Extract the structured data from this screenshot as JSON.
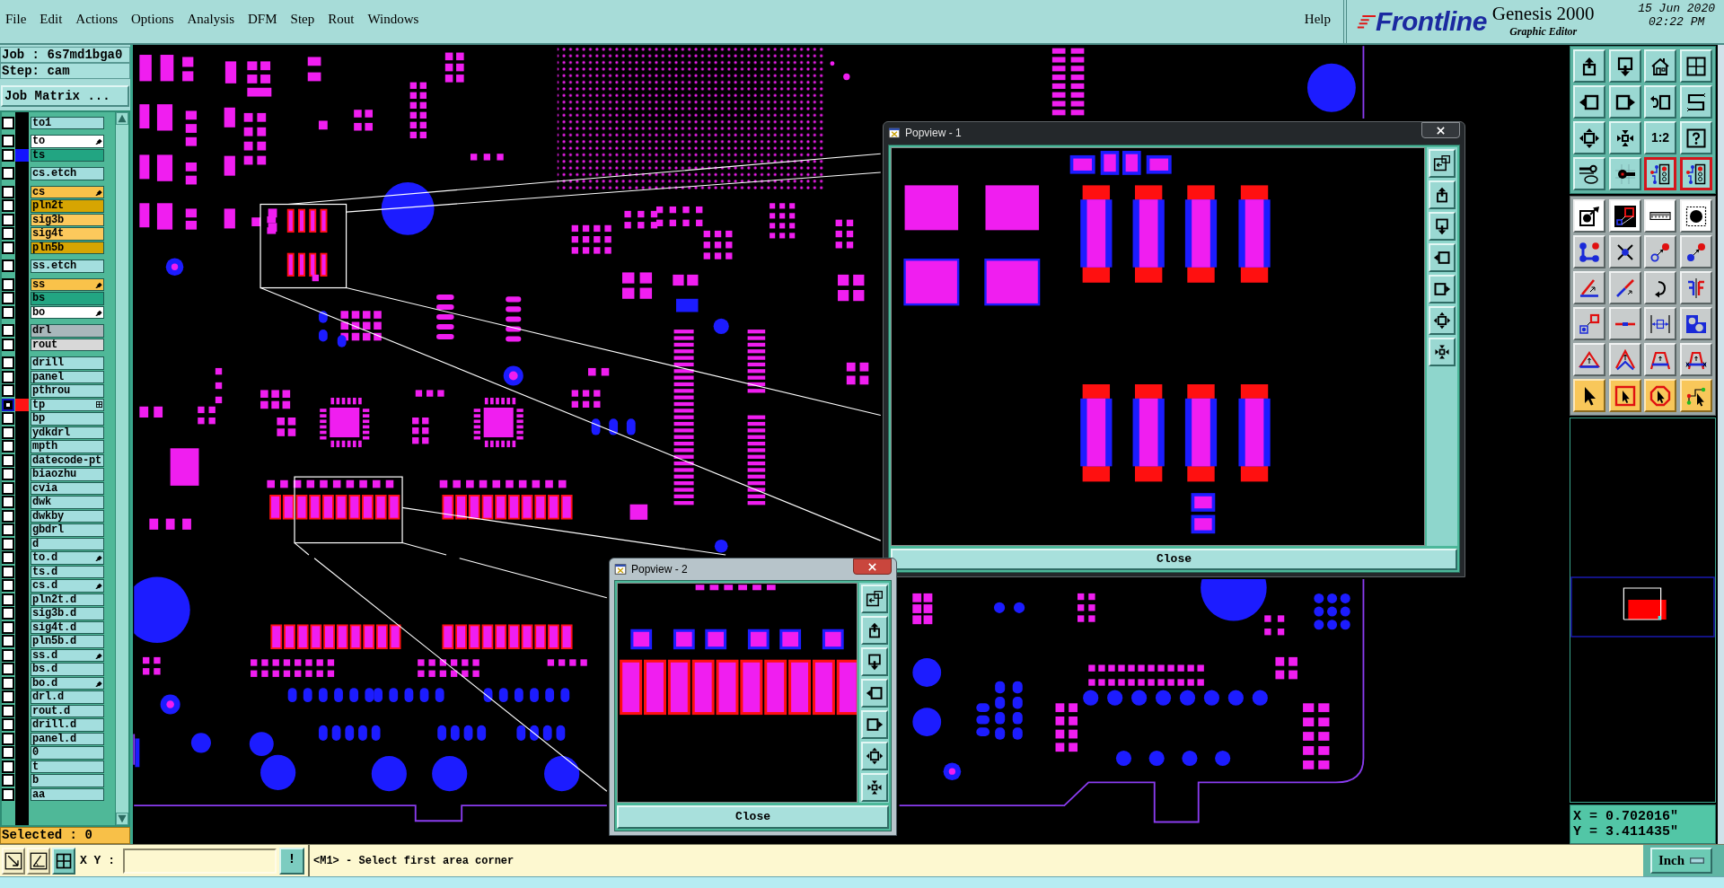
{
  "menu_bar": {
    "items": [
      "File",
      "Edit",
      "Actions",
      "Options",
      "Analysis",
      "DFM",
      "Step",
      "Rout",
      "Windows"
    ],
    "help": "Help"
  },
  "branding": {
    "logo": "Frontline",
    "product": "Genesis 2000",
    "subtitle": "Graphic Editor",
    "date": "15 Jun 2020",
    "time": "02:22 PM"
  },
  "job_panel": {
    "job": "Job : 6s7md1bga0",
    "step": "Step: cam",
    "matrix_button": "Job Matrix ...",
    "selected": "Selected : 0"
  },
  "layer_groups": [
    [
      {
        "name": "to1",
        "color": "#a3dede",
        "highlighted": false,
        "tagged": false,
        "work_layer": false
      }
    ],
    [
      {
        "name": "to",
        "color": "#ffffff",
        "highlighted": false,
        "tagged": true,
        "work_layer": false
      },
      {
        "name": "ts",
        "color": "#22a582",
        "swatch": {
          "color": "#1414ff"
        },
        "highlighted": false,
        "tagged": false,
        "work_layer": false
      }
    ],
    [
      {
        "name": "cs.etch",
        "color": "#a3dede",
        "highlighted": false,
        "tagged": false,
        "work_layer": false
      }
    ],
    [
      {
        "name": "cs",
        "color": "#f9c24a",
        "highlighted": false,
        "tagged": true,
        "work_layer": false
      },
      {
        "name": "pln2t",
        "color": "#d7a502",
        "highlighted": false,
        "tagged": false,
        "work_layer": false
      },
      {
        "name": "sig3b",
        "color": "#fcc95c",
        "highlighted": false,
        "tagged": false,
        "work_layer": false
      },
      {
        "name": "sig4t",
        "color": "#fcc95c",
        "highlighted": false,
        "tagged": false,
        "work_layer": false
      },
      {
        "name": "pln5b",
        "color": "#d7a502",
        "highlighted": false,
        "tagged": false,
        "work_layer": false
      }
    ],
    [
      {
        "name": "ss.etch",
        "color": "#a3dede",
        "highlighted": false,
        "tagged": false,
        "work_layer": false
      }
    ],
    [
      {
        "name": "ss",
        "color": "#f9c24a",
        "highlighted": false,
        "tagged": true,
        "work_layer": false
      },
      {
        "name": "bs",
        "color": "#22a582",
        "highlighted": false,
        "tagged": false,
        "work_layer": false
      },
      {
        "name": "bo",
        "color": "#ffffff",
        "highlighted": false,
        "tagged": true,
        "work_layer": false
      }
    ],
    [
      {
        "name": "drl",
        "color": "#a9b7bb",
        "highlighted": false,
        "tagged": false,
        "work_layer": false
      },
      {
        "name": "rout",
        "color": "#d8d8d8",
        "highlighted": false,
        "tagged": false,
        "work_layer": false
      }
    ],
    [
      {
        "name": "drill",
        "color": "#a3dede",
        "highlighted": false,
        "tagged": false,
        "work_layer": false
      },
      {
        "name": "panel",
        "color": "#a3dede",
        "highlighted": false,
        "tagged": false,
        "work_layer": false
      },
      {
        "name": "pthrou",
        "color": "#a3dede",
        "highlighted": false,
        "tagged": false,
        "work_layer": false
      },
      {
        "name": "tp",
        "color": "#a3dede",
        "swatch": {
          "color": "#ff1414"
        },
        "highlighted": true,
        "tagged": false,
        "work_layer": true
      },
      {
        "name": "bp",
        "color": "#a3dede",
        "highlighted": false,
        "tagged": false,
        "work_layer": false
      },
      {
        "name": "ydkdrl",
        "color": "#a3dede",
        "highlighted": false,
        "tagged": false,
        "work_layer": false
      },
      {
        "name": "mpth",
        "color": "#a3dede",
        "highlighted": false,
        "tagged": false,
        "work_layer": false
      },
      {
        "name": "datecode-pt",
        "color": "#a3dede",
        "highlighted": false,
        "tagged": false,
        "work_layer": false
      },
      {
        "name": "biaozhu",
        "color": "#a3dede",
        "highlighted": false,
        "tagged": false,
        "work_layer": false
      },
      {
        "name": "cvia",
        "color": "#a3dede",
        "highlighted": false,
        "tagged": false,
        "work_layer": false
      },
      {
        "name": "dwk",
        "color": "#a3dede",
        "highlighted": false,
        "tagged": false,
        "work_layer": false
      },
      {
        "name": "dwkby",
        "color": "#a3dede",
        "highlighted": false,
        "tagged": false,
        "work_layer": false
      },
      {
        "name": "gbdrl",
        "color": "#a3dede",
        "highlighted": false,
        "tagged": false,
        "work_layer": false
      },
      {
        "name": "d",
        "color": "#a3dede",
        "highlighted": false,
        "tagged": false,
        "work_layer": false
      },
      {
        "name": "to.d",
        "color": "#a3dede",
        "highlighted": false,
        "tagged": true,
        "work_layer": false
      },
      {
        "name": "ts.d",
        "color": "#a3dede",
        "highlighted": false,
        "tagged": false,
        "work_layer": false
      },
      {
        "name": "cs.d",
        "color": "#a3dede",
        "highlighted": false,
        "tagged": true,
        "work_layer": false
      },
      {
        "name": "pln2t.d",
        "color": "#a3dede",
        "highlighted": false,
        "tagged": false,
        "work_layer": false
      },
      {
        "name": "sig3b.d",
        "color": "#a3dede",
        "highlighted": false,
        "tagged": false,
        "work_layer": false
      },
      {
        "name": "sig4t.d",
        "color": "#a3dede",
        "highlighted": false,
        "tagged": false,
        "work_layer": false
      },
      {
        "name": "pln5b.d",
        "color": "#a3dede",
        "highlighted": false,
        "tagged": false,
        "work_layer": false
      },
      {
        "name": "ss.d",
        "color": "#a3dede",
        "highlighted": false,
        "tagged": true,
        "work_layer": false
      },
      {
        "name": "bs.d",
        "color": "#a3dede",
        "highlighted": false,
        "tagged": false,
        "work_layer": false
      },
      {
        "name": "bo.d",
        "color": "#a3dede",
        "highlighted": false,
        "tagged": true,
        "work_layer": false
      },
      {
        "name": "drl.d",
        "color": "#a3dede",
        "highlighted": false,
        "tagged": false,
        "work_layer": false
      },
      {
        "name": "rout.d",
        "color": "#a3dede",
        "highlighted": false,
        "tagged": false,
        "work_layer": false
      },
      {
        "name": "drill.d",
        "color": "#a3dede",
        "highlighted": false,
        "tagged": false,
        "work_layer": false
      },
      {
        "name": "panel.d",
        "color": "#a3dede",
        "highlighted": false,
        "tagged": false,
        "work_layer": false
      },
      {
        "name": "0",
        "color": "#a3dede",
        "highlighted": false,
        "tagged": false,
        "work_layer": false
      },
      {
        "name": "t",
        "color": "#a3dede",
        "highlighted": false,
        "tagged": false,
        "work_layer": false
      },
      {
        "name": "b",
        "color": "#a3dede",
        "highlighted": false,
        "tagged": false,
        "work_layer": false
      },
      {
        "name": "aa",
        "color": "#a3dede",
        "highlighted": false,
        "tagged": false,
        "work_layer": false
      }
    ]
  ],
  "toolbar": {
    "ratio_button": "1:2"
  },
  "popviews": [
    {
      "title": "Popview - 1",
      "active": false,
      "close_button": "Close"
    },
    {
      "title": "Popview - 2",
      "active": true,
      "close_button": "Close"
    }
  ],
  "coordinates": {
    "x": "X = 0.702016\"",
    "y": "Y = 3.411435\""
  },
  "command_bar": {
    "tools": [
      {
        "kind": "diagonal",
        "selected": false
      },
      {
        "kind": "angle",
        "selected": false
      },
      {
        "kind": "grid",
        "selected": true
      }
    ],
    "label": "X Y :",
    "execute_button": "!",
    "prompt": "<M1> - Select first area corner",
    "units": "Inch"
  }
}
